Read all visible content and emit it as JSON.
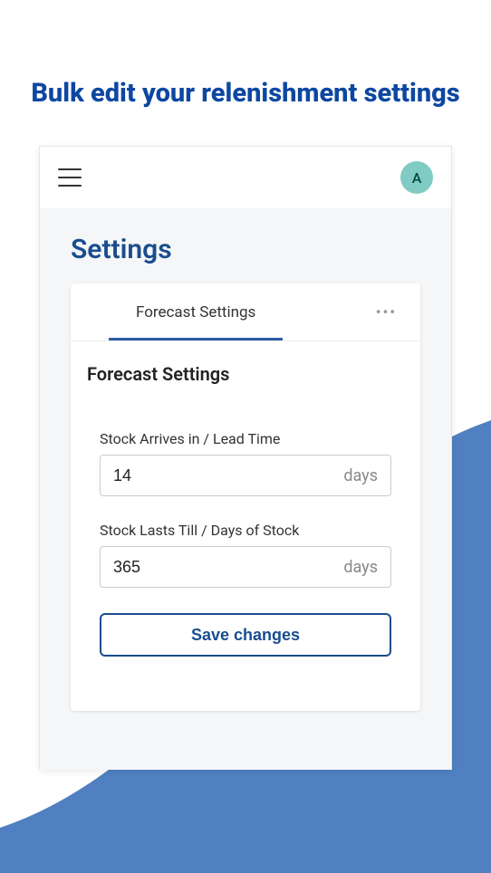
{
  "headline": "Bulk edit your relenishment settings",
  "header": {
    "avatar_letter": "A"
  },
  "page_title": "Settings",
  "tab": {
    "label": "Forecast Settings"
  },
  "section_title": "Forecast Settings",
  "lead_time": {
    "label": "Stock Arrives in / Lead Time",
    "value": "14",
    "unit": "days"
  },
  "days_stock": {
    "label": "Stock Lasts Till / Days of Stock",
    "value": "365",
    "unit": "days"
  },
  "save_label": "Save changes",
  "colors": {
    "accent": "#1a4d8f",
    "wave": "#5080c1"
  }
}
